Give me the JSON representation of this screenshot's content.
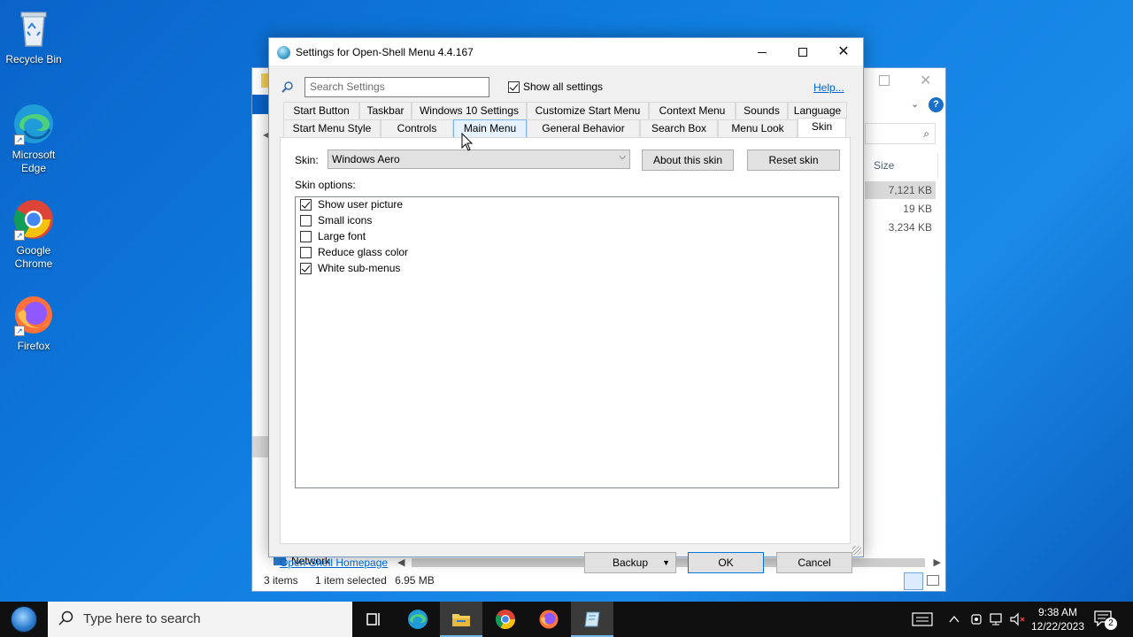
{
  "desktop": {
    "icons": [
      {
        "label": "Recycle Bin",
        "icon": "recycle-bin-icon"
      },
      {
        "label": "Microsoft Edge",
        "icon": "edge-icon"
      },
      {
        "label": "Google Chrome",
        "icon": "chrome-icon"
      },
      {
        "label": "Firefox",
        "icon": "firefox-icon"
      }
    ]
  },
  "explorer": {
    "column_header_size": "Size",
    "sizes": [
      "7,121 KB",
      "19 KB",
      "3,234 KB"
    ],
    "nav_network": "Network",
    "status": {
      "items": "3 items",
      "selected": "1 item selected",
      "selected_size": "6.95 MB"
    }
  },
  "dialog": {
    "title": "Settings for Open-Shell Menu 4.4.167",
    "search_placeholder": "Search Settings",
    "show_all_label": "Show all settings",
    "show_all_checked": true,
    "help_label": "Help...",
    "tabs_row1": [
      "Start Button",
      "Taskbar",
      "Windows 10 Settings",
      "Customize Start Menu",
      "Context Menu",
      "Sounds",
      "Language"
    ],
    "tabs_row2": [
      "Start Menu Style",
      "Controls",
      "Main Menu",
      "General Behavior",
      "Search Box",
      "Menu Look",
      "Skin"
    ],
    "active_tab": "Skin",
    "skin_label": "Skin:",
    "skin_value": "Windows Aero",
    "about_skin_label": "About this skin",
    "reset_skin_label": "Reset skin",
    "skin_options_label": "Skin options:",
    "options": [
      {
        "label": "Show user picture",
        "checked": true
      },
      {
        "label": "Small icons",
        "checked": false
      },
      {
        "label": "Large font",
        "checked": false
      },
      {
        "label": "Reduce glass color",
        "checked": false
      },
      {
        "label": "White sub-menus",
        "checked": true
      }
    ],
    "homepage_link": "Open-Shell Homepage",
    "backup_label": "Backup",
    "ok_label": "OK",
    "cancel_label": "Cancel"
  },
  "taskbar": {
    "search_placeholder": "Type here to search",
    "apps": [
      "task-view-icon",
      "edge-icon",
      "file-explorer-icon",
      "chrome-icon",
      "firefox-icon",
      "open-shell-settings-icon"
    ],
    "clock_time": "9:38 AM",
    "clock_date": "12/22/2023",
    "notification_count": "2"
  },
  "colors": {
    "accent": "#0078d7",
    "link": "#0066cc",
    "desktop_bg": "#0f7ee0",
    "taskbar_bg": "#101010"
  }
}
